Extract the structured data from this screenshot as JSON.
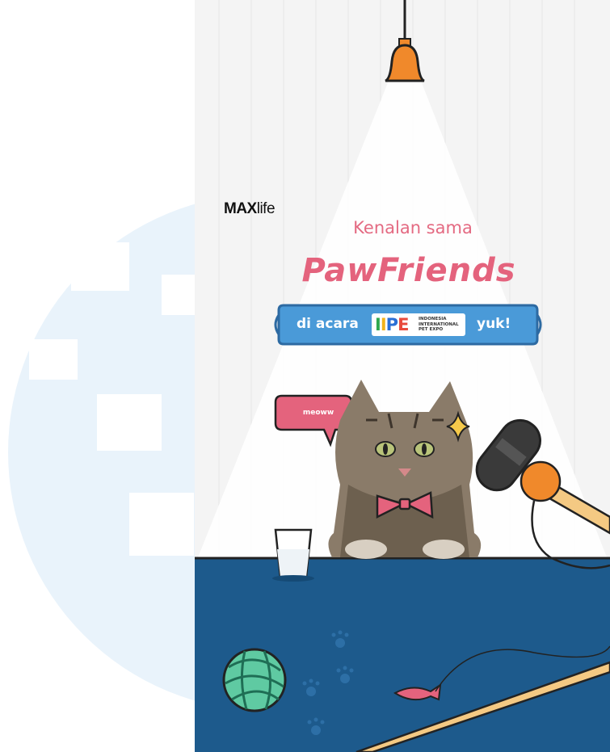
{
  "brand": {
    "bold": "MAX",
    "light": "life"
  },
  "headline": {
    "line1": "Kenalan sama",
    "line2": "PawFriends"
  },
  "banner": {
    "left": "di acara",
    "right": "yuk!",
    "event_logo": [
      "I",
      "I",
      "P",
      "E"
    ],
    "event_logo_colors": [
      "#2fa84f",
      "#f2b21b",
      "#2a6fd6",
      "#e84a3c"
    ],
    "event_subtitle": [
      "INDONESIA",
      "INTERNATIONAL",
      "PET EXPO"
    ]
  },
  "speech_bubble": "meoww",
  "colors": {
    "table": "#1d5a8c",
    "wall": "#f7f7f7",
    "lamp": "#f0892b",
    "banner": "#4a9ad8",
    "headline": "#e4637d",
    "bowtie": "#e4637d"
  },
  "icons": [
    "lamp-icon",
    "cat-photo",
    "bowtie-icon",
    "sparkle-icon",
    "milk-glass-icon",
    "microphone-icon",
    "yarn-ball-icon",
    "fish-toy-icon",
    "paw-print-icon"
  ]
}
